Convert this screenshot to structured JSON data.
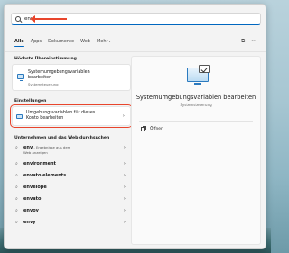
{
  "search": {
    "query": "env"
  },
  "tabs": [
    {
      "label": "Alle"
    },
    {
      "label": "Apps"
    },
    {
      "label": "Dokumente"
    },
    {
      "label": "Web"
    },
    {
      "label": "Mehr"
    }
  ],
  "best_match": {
    "section_title": "Höchste Übereinstimmung",
    "title_line1": "Systemumgebungsvariablen",
    "title_line2": "bearbeiten",
    "subtitle": "Systemsteuerung"
  },
  "settings": {
    "section_title": "Einstellungen",
    "item_line1": "Umgebungsvariablen für dieses",
    "item_line2": "Konto bearbeiten"
  },
  "web": {
    "section_title": "Unternehmen und das Web durchsuchen",
    "items": [
      {
        "term": "env",
        "suffix": " - Ergebnisse aus dem",
        "suffix2": "Web anzeigen"
      },
      {
        "term": "environment"
      },
      {
        "term": "envato elements"
      },
      {
        "term": "envelope"
      },
      {
        "term": "envato"
      },
      {
        "term": "envoy"
      },
      {
        "term": "envy"
      }
    ]
  },
  "preview": {
    "title": "Systemumgebungsvariablen bearbeiten",
    "subtitle": "Systemsteuerung",
    "action_open": "Öffnen"
  },
  "colors": {
    "accent": "#0067c0",
    "highlight": "#e8452c"
  }
}
